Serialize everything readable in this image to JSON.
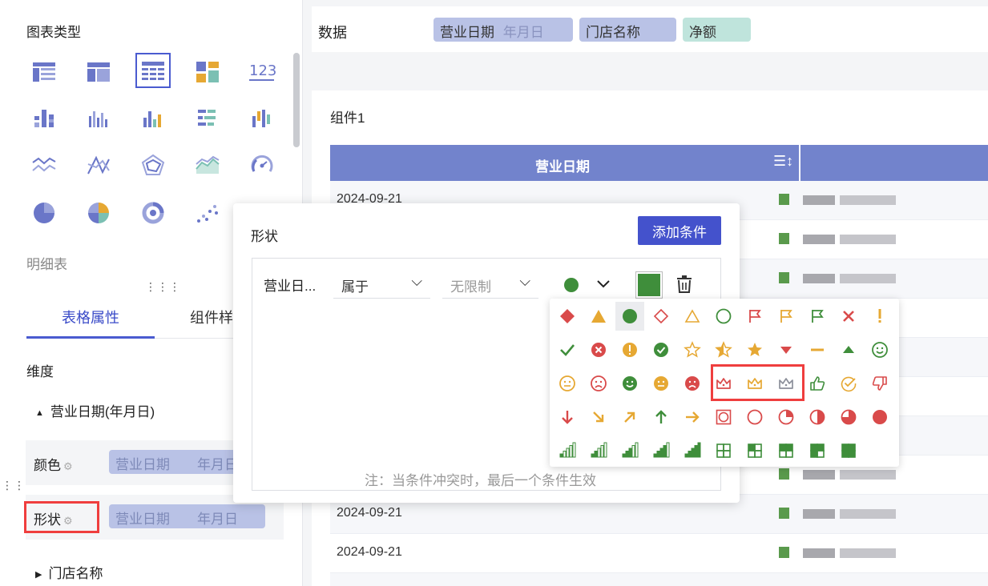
{
  "sidebar": {
    "chart_type_title": "图表类型",
    "chart_icons": [
      "table-icon",
      "cross-table-icon",
      "detail-table-icon",
      "treemap-icon",
      "kpi-number-icon",
      "grouped-bar-icon",
      "bar-chart-icon",
      "column-chart-icon",
      "horizontal-bar-icon",
      "multi-color-bar-icon",
      "line-chart-icon",
      "stock-line-icon",
      "radar-chart-icon",
      "area-chart-icon",
      "gauge-icon",
      "pie-chart-icon",
      "multi-pie-icon",
      "ring-chart-icon",
      "scatter-icon"
    ],
    "kpi_text": "123",
    "selected_chart_name": "明细表",
    "tabs": [
      "表格属性",
      "组件样"
    ],
    "dimension_title": "维度",
    "tree_item_date": "营业日期(年月日)",
    "tree_item_store": "门店名称",
    "color_row": {
      "label": "颜色",
      "pill_field": "营业日期",
      "pill_unit": "年月日"
    },
    "shape_row": {
      "label": "形状",
      "pill_field": "营业日期",
      "pill_unit": "年月日"
    }
  },
  "data_bar": {
    "label": "数据",
    "pills": [
      {
        "text": "营业日期",
        "sub": "年月日",
        "bg": "#b9c2e6"
      },
      {
        "text": "门店名称",
        "bg": "#b9c2e6"
      },
      {
        "text": "净额",
        "bg": "#bfe4dc"
      }
    ]
  },
  "component": {
    "title": "组件1",
    "table": {
      "header": "营业日期",
      "rows": [
        "2024-09-21",
        "",
        "",
        "",
        "",
        "",
        "",
        "",
        "2024-09-21",
        "2024-09-21",
        "2024-09-21"
      ]
    }
  },
  "popup": {
    "title": "形状",
    "add_button": "添加条件",
    "condition": {
      "field": "营业日...",
      "operator": "属于",
      "value_placeholder": "无限制",
      "color": "#3f8e3b"
    },
    "note": "注：当条件冲突时，最后一个条件生效"
  },
  "palette": {
    "icons": [
      [
        "diamond-red-icon",
        "triangle-yellow-icon",
        "circle-green-icon",
        "diamond-outline-red-icon",
        "triangle-outline-yellow-icon",
        "circle-outline-green-icon",
        "flag-outline-red-icon",
        "flag-outline-yellow-icon",
        "flag-outline-green-icon",
        "cross-red-icon",
        "exclamation-yellow-icon"
      ],
      [
        "check-green-icon",
        "cross-circle-red-icon",
        "exclamation-circle-yellow-icon",
        "check-circle-green-icon",
        "star-outline-yellow-icon",
        "star-half-yellow-icon",
        "star-yellow-icon",
        "arrow-down-red-icon",
        "dash-yellow-icon",
        "arrow-up-green-icon",
        "smile-outline-green-icon"
      ],
      [
        "neutral-face-yellow-icon",
        "sad-face-red-icon",
        "smile-face-green-icon",
        "neutral-face-solid-yellow-icon",
        "sad-face-solid-red-icon",
        "crown-red-icon",
        "crown-yellow-icon",
        "crown-gray-icon",
        "thumbs-up-green-icon",
        "check-circle-outline-yellow-icon",
        "thumbs-down-red-icon"
      ],
      [
        "arrow-down-red-icon",
        "arrow-down-right-yellow-icon",
        "arrow-up-right-yellow-icon",
        "arrow-up-green-icon",
        "arrow-right-yellow-icon",
        "square-circle-red-icon",
        "circle-empty-red-icon",
        "circle-quarter-red-icon",
        "circle-half-red-icon",
        "circle-three-quarter-red-icon",
        "circle-full-red-icon"
      ],
      [
        "signal-1-green-icon",
        "signal-2-green-icon",
        "signal-3-green-icon",
        "signal-4-green-icon",
        "signal-5-green-icon",
        "grid-empty-green-icon",
        "grid-quarter-green-icon",
        "grid-half-green-icon",
        "grid-three-quarter-green-icon",
        "grid-full-green-icon"
      ]
    ],
    "colors": {
      "red": "#d94a4a",
      "yellow": "#e6a833",
      "green": "#3f8e3b",
      "gray": "#8c8f9a"
    }
  }
}
